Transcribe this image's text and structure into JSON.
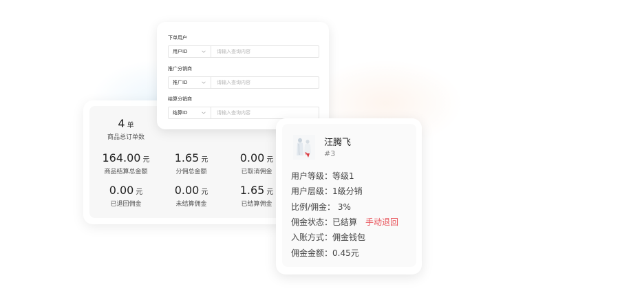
{
  "filters": [
    {
      "label": "下单用户",
      "select_value": "用户ID",
      "placeholder": "请输入查询内容"
    },
    {
      "label": "推广分销商",
      "select_value": "推广ID",
      "placeholder": "请输入查询内容"
    },
    {
      "label": "结算分销商",
      "select_value": "结算ID",
      "placeholder": "请输入查询内容"
    }
  ],
  "stats": {
    "orders": {
      "value": "4",
      "unit": "单",
      "caption": "商品总订单数"
    },
    "settle_total": {
      "value": "164.00",
      "unit": "元",
      "caption": "商品结算总金额"
    },
    "commission_total": {
      "value": "1.65",
      "unit": "元",
      "caption": "分佣总金额"
    },
    "cancelled": {
      "value": "0.00",
      "unit": "元",
      "caption": "已取消佣金"
    },
    "refunded": {
      "value": "0.00",
      "unit": "元",
      "caption": "已退回佣金"
    },
    "unsettled": {
      "value": "0.00",
      "unit": "元",
      "caption": "未结算佣金"
    },
    "settled": {
      "value": "1.65",
      "unit": "元",
      "caption": "已结算佣金"
    }
  },
  "user": {
    "name": "汪腾飞",
    "id": "#3",
    "level": "用户等级：等级1",
    "tier": "用户层级：1级分销",
    "ratio": "比例/佣金： 3%",
    "status": "佣金状态：已结算",
    "refund_action": "手动退回",
    "account_method": "入账方式：佣金钱包",
    "amount": "佣金金额：0.45元"
  },
  "colors": {
    "refund_action": "#e8545b",
    "card_background": "#ffffff",
    "panel_background": "#f7f7f7"
  }
}
